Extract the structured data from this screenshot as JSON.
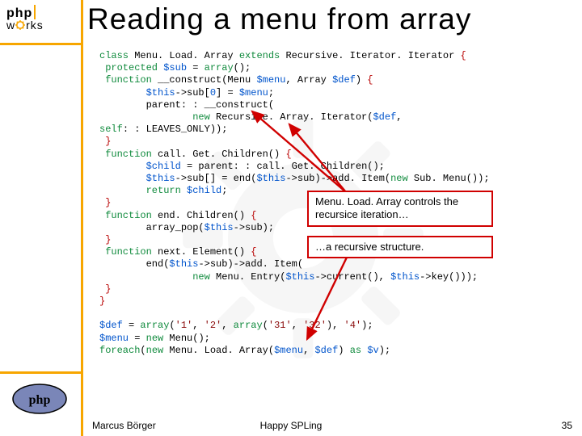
{
  "logo": {
    "line1": "php",
    "line2_prefix_works": "w",
    "line2_rest": "rks"
  },
  "title": "Reading a menu from array",
  "code": {
    "l01a": "class",
    "l01b": " Menu. Load. Array ",
    "l01c": "extends",
    "l01d": " Recursive. Iterator. Iterator ",
    "l01e": "{",
    "l02a": " protected ",
    "l02b": "$sub",
    "l02c": " = ",
    "l02d": "array",
    "l02e": "();",
    "l03a": " function ",
    "l03b": "__construct",
    "l03c": "(Menu ",
    "l03d": "$menu",
    "l03e": ", Array ",
    "l03f": "$def",
    "l03g": ") ",
    "l03h": "{",
    "l04a": "        ",
    "l04b": "$this",
    "l04c": "->sub[",
    "l04d": "0",
    "l04e": "] = ",
    "l04f": "$menu",
    "l04g": ";",
    "l05a": "        parent",
    "l05b": ": : __construct",
    "l05c": "(",
    "l06a": "                ",
    "l06b": "new",
    "l06c": " Recursive. Array. Iterator(",
    "l06d": "$def",
    "l06e": ",",
    "l07a": "self",
    "l07b": ": : LEAVES_ONLY));",
    "l08a": " ",
    "l08b": "}",
    "l09a": " function ",
    "l09b": "call. Get. Children",
    "l09c": "() ",
    "l09d": "{",
    "l10a": "        ",
    "l10b": "$child",
    "l10c": " = parent",
    "l10d": ": : call. Get. Children",
    "l10e": "();",
    "l11a": "        ",
    "l11b": "$this",
    "l11c": "->sub[] = end(",
    "l11d": "$this",
    "l11e": "->sub)->add. Item(",
    "l11f": "new",
    "l11g": " Sub. Menu());",
    "l12a": "        ",
    "l12b": "return ",
    "l12c": "$child",
    "l12d": ";",
    "l13a": " ",
    "l13b": "}",
    "l14a": " function ",
    "l14b": "end. Children",
    "l14c": "() ",
    "l14d": "{",
    "l15a": "        array_pop(",
    "l15b": "$this",
    "l15c": "->sub);",
    "l16a": " ",
    "l16b": "}",
    "l17a": " function ",
    "l17b": "next. Element",
    "l17c": "() ",
    "l17d": "{",
    "l18a": "        end(",
    "l18b": "$this",
    "l18c": "->sub)->add. Item(",
    "l19a": "                ",
    "l19b": "new",
    "l19c": " Menu. Entry(",
    "l19d": "$this",
    "l19e": "->current(), ",
    "l19f": "$this",
    "l19g": "->key()));",
    "l20a": " ",
    "l20b": "}",
    "l21a": "",
    "l21b": "}",
    "l22": "",
    "l23a": "$def",
    "l23b": " = ",
    "l23c": "array",
    "l23d": "(",
    "l23e": "'1'",
    "l23f": ", ",
    "l23g": "'2'",
    "l23h": ", ",
    "l23i": "array",
    "l23j": "(",
    "l23k": "'31'",
    "l23l": ", ",
    "l23m": "'32'",
    "l23n": "), ",
    "l23o": "'4'",
    "l23p": ");",
    "l24a": "$menu",
    "l24b": " = ",
    "l24c": "new",
    "l24d": " Menu();",
    "l25a": "foreach",
    "l25b": "(",
    "l25c": "new",
    "l25d": " Menu. Load. Array(",
    "l25e": "$menu",
    "l25f": ", ",
    "l25g": "$def",
    "l25h": ") ",
    "l25i": "as",
    "l25j": " ",
    "l25k": "$v",
    "l25l": ");"
  },
  "callouts": {
    "c1": "Menu. Load. Array controls the recursice iteration…",
    "c2": "…a recursive structure."
  },
  "footer": {
    "author": "Marcus Börger",
    "center": "Happy SPLing",
    "page": "35"
  },
  "colors": {
    "accent": "#f7a600",
    "callout_border": "#d00000"
  }
}
